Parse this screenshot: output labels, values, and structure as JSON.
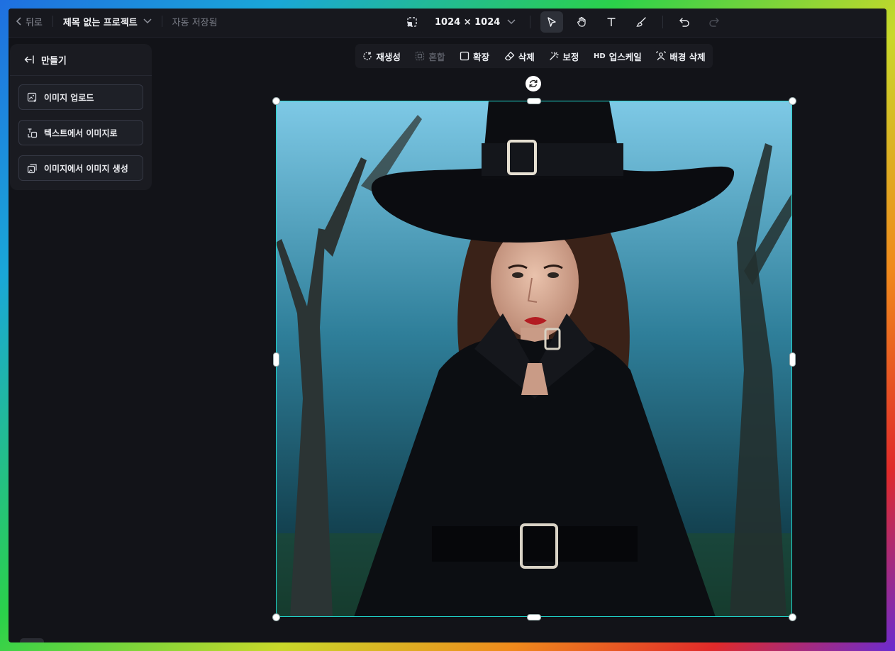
{
  "topbar": {
    "back_label": "뒤로",
    "project_title": "제목 없는 프로젝트",
    "autosave": "자동 저장됨",
    "canvas_size": "1024 × 1024"
  },
  "panel": {
    "title": "만들기",
    "buttons": [
      {
        "label": "이미지 업로드"
      },
      {
        "label": "텍스트에서 이미지로"
      },
      {
        "label": "이미지에서 이미지 생성"
      }
    ]
  },
  "image_toolbar": {
    "regenerate": "재생성",
    "blend": "혼합",
    "expand": "확장",
    "erase": "삭제",
    "retouch": "보정",
    "hd_badge": "HD",
    "upscale": "업스케일",
    "remove_bg": "배경 삭제"
  },
  "colors": {
    "selection": "#20d6cc",
    "background": "#121318",
    "panel": "#1a1b21"
  }
}
